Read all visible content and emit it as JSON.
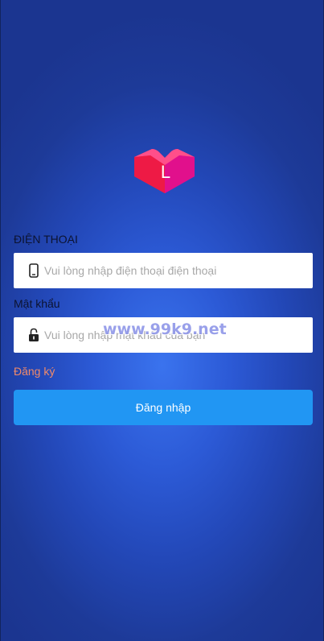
{
  "app": {
    "logo_letter": "L",
    "logo_colors": [
      "#f0207a",
      "#e8134a",
      "#ff3fb0"
    ]
  },
  "phone": {
    "label": "ĐIỆN THOẠI",
    "placeholder": "Vui lòng nhập điện thoại điện thoại",
    "icon": "mobile-phone-icon"
  },
  "password": {
    "label": "Mật khẩu",
    "placeholder": "Vui lòng nhập mật khẩu của bạn",
    "icon": "lock-icon"
  },
  "register_link": "Đăng ký",
  "login_button": "Đăng nhập",
  "watermark": "www.99k9.net",
  "colors": {
    "button": "#2196f3",
    "register_link": "#f08a6a",
    "background": "#2a55d0"
  }
}
